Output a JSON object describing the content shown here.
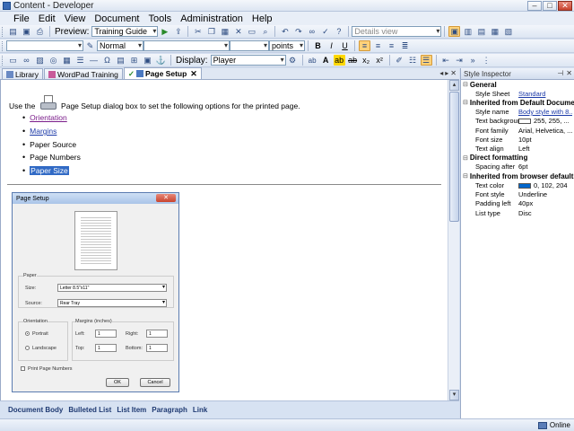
{
  "window": {
    "title": "Content - Developer"
  },
  "menu": [
    "File",
    "Edit",
    "View",
    "Document",
    "Tools",
    "Administration",
    "Help"
  ],
  "toolbar": {
    "preview_label": "Preview:",
    "preview_value": "Training Guide",
    "view_value": "Details view",
    "paragraph_style": "Normal",
    "size_unit": "points",
    "display_label": "Display:",
    "display_value": "Player"
  },
  "tabs": [
    {
      "label": "Library",
      "active": false
    },
    {
      "label": "WordPad Training",
      "active": false
    },
    {
      "label": "Page Setup",
      "active": true
    }
  ],
  "document": {
    "intro_before": "Use the",
    "intro_after": "Page Setup dialog box to set the following options for the printed page.",
    "items": [
      "Orientation",
      "Margins",
      "Paper Source",
      "Page Numbers",
      "Paper Size"
    ]
  },
  "dialog": {
    "title": "Page Setup",
    "paper_group": "Paper",
    "size_label": "Size:",
    "size_value": "Letter 8.5\"x11\"",
    "source_label": "Source:",
    "source_value": "Rear Tray",
    "orientation_group": "Orientation",
    "portrait": "Portrait",
    "landscape": "Landscape",
    "margins_group": "Margins (inches)",
    "left_label": "Left:",
    "left_value": "1",
    "right_label": "Right:",
    "right_value": "1",
    "top_label": "Top:",
    "top_value": "1",
    "bottom_label": "Bottom:",
    "bottom_value": "1",
    "print_page_numbers": "Print Page Numbers",
    "ok": "OK",
    "cancel": "Cancel"
  },
  "path": [
    "Document Body",
    "Bulleted List",
    "List Item",
    "Paragraph",
    "Link"
  ],
  "inspector": {
    "title": "Style Inspector",
    "sections": [
      {
        "name": "General",
        "props": [
          {
            "k": "Style Sheet",
            "v": "Standard",
            "link": true
          }
        ]
      },
      {
        "name": "Inherited from Default Document",
        "props": [
          {
            "k": "Style name",
            "v": "Body style with 8...",
            "link": true
          },
          {
            "k": "Text backgrour",
            "v": "255, 255, ...",
            "swatch": "#ffffff"
          },
          {
            "k": "Font family",
            "v": "Arial, Helvetica, ..."
          },
          {
            "k": "Font size",
            "v": "10pt"
          },
          {
            "k": "Text align",
            "v": "Left"
          }
        ]
      },
      {
        "name": "Direct formatting",
        "props": [
          {
            "k": "Spacing after",
            "v": "6pt"
          }
        ]
      },
      {
        "name": "Inherited from browser defaults",
        "props": [
          {
            "k": "Text color",
            "v": "0, 102, 204",
            "swatch": "#0066cc"
          },
          {
            "k": "Font style",
            "v": "Underline"
          },
          {
            "k": "Padding left",
            "v": "40px"
          },
          {
            "k": "List type",
            "v": "Disc"
          }
        ]
      }
    ]
  },
  "status": {
    "connection": "Online"
  },
  "colors": {
    "accent": "#316ac5",
    "link": "#1c3aa8",
    "visited": "#7a1c8a"
  }
}
